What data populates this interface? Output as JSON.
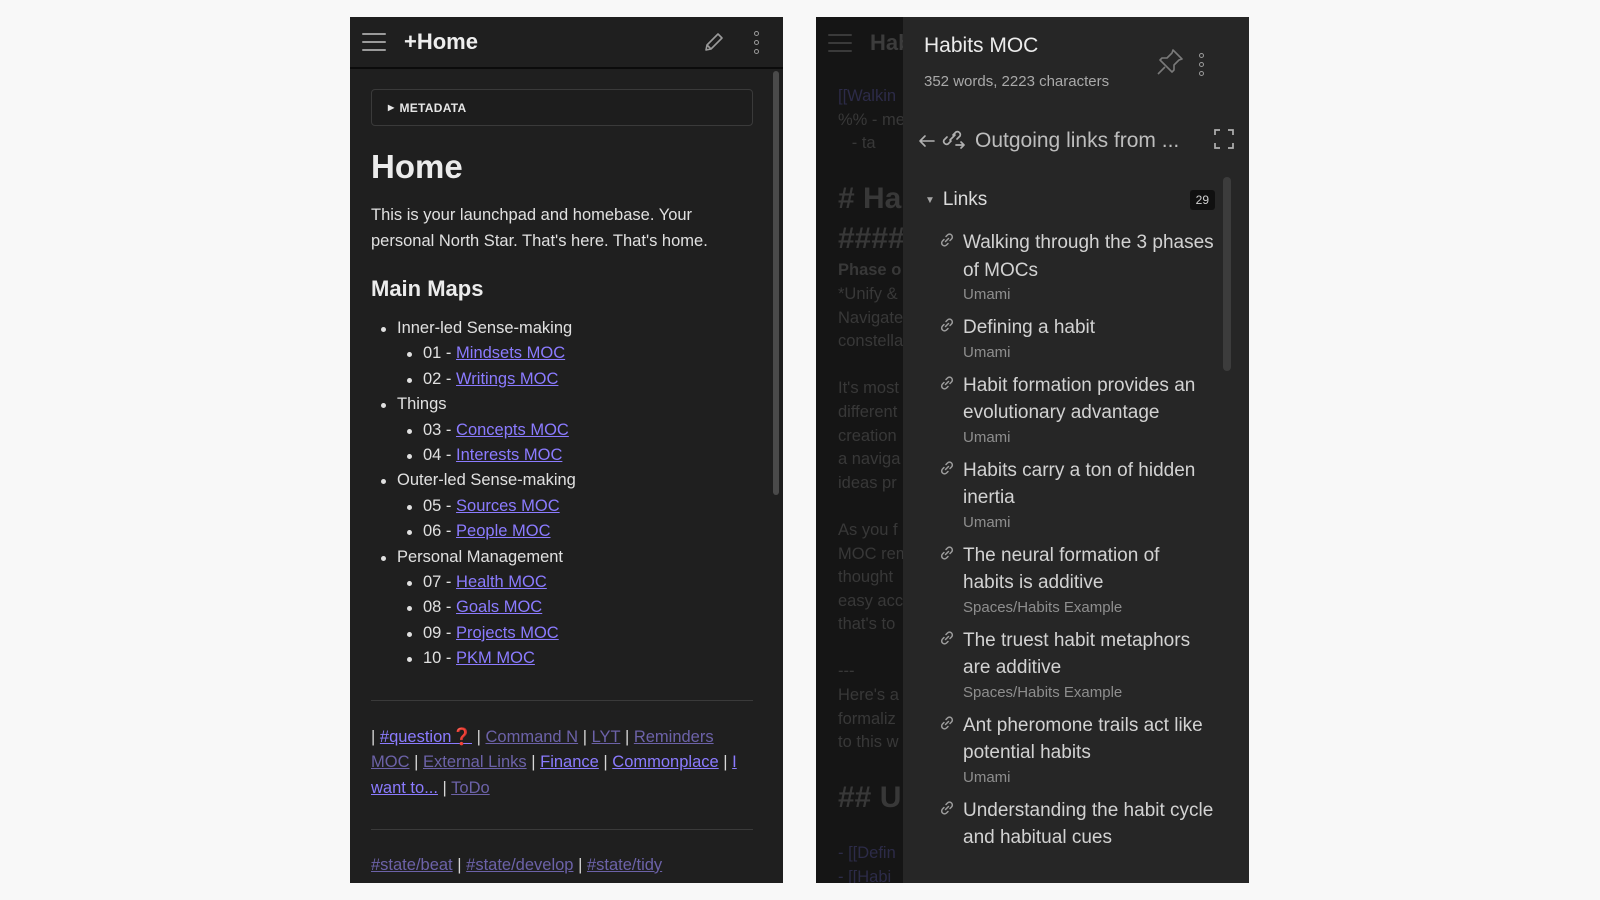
{
  "left": {
    "header": {
      "title": "+Home"
    },
    "metadata_label": "METADATA",
    "page_title": "Home",
    "intro": "This is your launchpad and homebase. Your personal North Star. That's here. That's home.",
    "section_title": "Main Maps",
    "groups": [
      {
        "label": "Inner-led Sense-making",
        "items": [
          {
            "num": "01 - ",
            "link": "Mindsets MOC"
          },
          {
            "num": "02 - ",
            "link": "Writings MOC"
          }
        ]
      },
      {
        "label": "Things",
        "items": [
          {
            "num": "03 - ",
            "link": "Concepts MOC"
          },
          {
            "num": "04 - ",
            "link": "Interests MOC"
          }
        ]
      },
      {
        "label": "Outer-led Sense-making",
        "items": [
          {
            "num": "05 - ",
            "link": "Sources MOC"
          },
          {
            "num": "06 - ",
            "link": "People MOC"
          }
        ]
      },
      {
        "label": "Personal Management",
        "items": [
          {
            "num": "07 - ",
            "link": "Health MOC"
          },
          {
            "num": "08 - ",
            "link": "Goals MOC"
          },
          {
            "num": "09 - ",
            "link": "Projects MOC"
          },
          {
            "num": "10 - ",
            "link": "PKM MOC"
          }
        ]
      }
    ],
    "footer": {
      "sep": "|",
      "question": "#question",
      "qmark": "❓",
      "command_n": "Command N",
      "lyt": "LYT",
      "reminders": "Reminders MOC",
      "external": "External Links",
      "finance": "Finance",
      "commonplace": "Commonplace",
      "i_want_to": "I want to...",
      "todo": "ToDo"
    },
    "tags": {
      "t1": "#state/beat",
      "t2": "#state/develop",
      "t3": "#state/tidy",
      "sep": "|"
    }
  },
  "right": {
    "bg_title": "Hab",
    "bg_lines": [
      "[[Walkin",
      "%% - me",
      "   - ta",
      "",
      "# Ha",
      "#####",
      "Phase o",
      "*Unify &",
      "Navigate",
      "constella",
      "",
      "It's most",
      "different",
      "creation",
      "a naviga",
      "ideas pr",
      "",
      "As you f",
      "MOC rem",
      "thought",
      "easy acc",
      "that's to",
      "",
      "---",
      "Here's a",
      "formaliz",
      "to this w",
      "",
      "## U",
      "",
      "- [[Defin",
      "- [[Habi"
    ],
    "sidebar": {
      "title": "Habits MOC",
      "stats": "352 words, 2223 characters",
      "outgoing_title": "Outgoing links from ...",
      "links_label": "Links",
      "links_count": "29",
      "links": [
        {
          "title": "Walking through the 3 phases of MOCs",
          "path": "Umami"
        },
        {
          "title": "Defining a habit",
          "path": "Umami"
        },
        {
          "title": "Habit formation provides an evolutionary advantage",
          "path": "Umami"
        },
        {
          "title": "Habits carry a ton of hidden inertia",
          "path": "Umami"
        },
        {
          "title": "The neural formation of habits is additive",
          "path": "Spaces/Habits Example"
        },
        {
          "title": "The truest habit metaphors are additive",
          "path": "Spaces/Habits Example"
        },
        {
          "title": "Ant pheromone trails act like potential habits",
          "path": "Umami"
        },
        {
          "title": "Understanding the habit cycle and habitual cues",
          "path": ""
        }
      ]
    }
  },
  "colors": {
    "link": "#8b7bff",
    "link_dim": "#6c62a8",
    "background": "#1f1f1f",
    "sidebar": "#262626"
  }
}
